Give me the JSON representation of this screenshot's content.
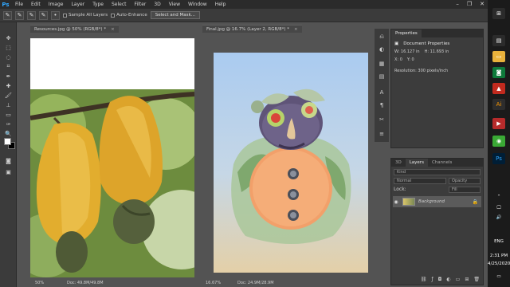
{
  "app": {
    "logo": "Ps"
  },
  "menu": [
    "File",
    "Edit",
    "Image",
    "Layer",
    "Type",
    "Select",
    "Filter",
    "3D",
    "View",
    "Window",
    "Help"
  ],
  "window_controls": {
    "minimize": "–",
    "restore": "❐",
    "close": "✕"
  },
  "options_bar": {
    "brush_size": "•",
    "sample_all_layers": "Sample All Layers",
    "auto_enhance": "Auto-Enhance",
    "select_mask": "Select and Mask..."
  },
  "documents": {
    "left": {
      "tab": "Resources.jpg @ 50% (RGB/8*) *",
      "zoom": "50%",
      "doc_size": "Doc: 49.8M/49.8M"
    },
    "right": {
      "tab": "Final.jpg @ 16.7% (Layer 2, RGB/8*) *",
      "zoom": "16.67%",
      "doc_size": "Doc: 24.9M/28.9M"
    }
  },
  "properties": {
    "tab": "Properties",
    "title": "Document Properties",
    "w": "W: 16.127 in",
    "h": "H: 11.693 in",
    "x": "X: 0",
    "y": "Y: 0",
    "resolution": "Resolution: 300 pixels/inch"
  },
  "layers_panel": {
    "tabs": [
      "3D",
      "Layers",
      "Channels"
    ],
    "kind": "Kind",
    "blend_mode": "Normal",
    "opacity": "Opacity",
    "lock": "Lock:",
    "fill": "Fill",
    "layer_name": "Background"
  },
  "taskbar": {
    "lang": "ENG",
    "time": "2:31 PM",
    "date": "4/25/2020"
  },
  "colors": {
    "accent": "#31a8ff",
    "fg_swatch": "#ffffff",
    "bg_swatch": "#000000"
  }
}
